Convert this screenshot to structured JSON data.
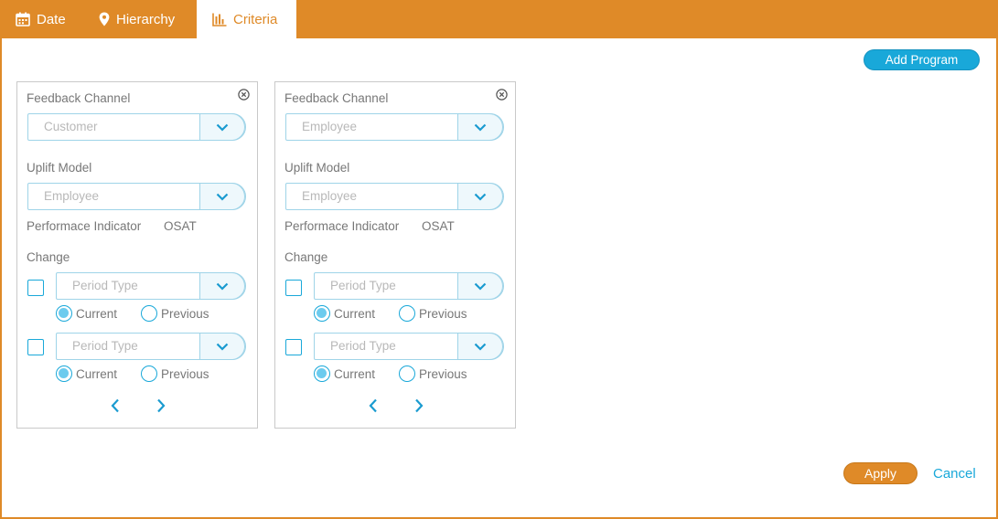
{
  "tabs": [
    {
      "label": "Date",
      "icon": "calendar-icon",
      "active": false
    },
    {
      "label": "Hierarchy",
      "icon": "map-pin-icon",
      "active": false
    },
    {
      "label": "Criteria",
      "icon": "bar-chart-icon",
      "active": true
    }
  ],
  "actions": {
    "add_program": "Add Program",
    "apply": "Apply",
    "cancel": "Cancel"
  },
  "colors": {
    "accent_orange": "#df8a28",
    "accent_blue": "#19a8d9"
  },
  "cards": [
    {
      "feedback_label": "Feedback Channel",
      "feedback_value": "Customer",
      "uplift_label": "Uplift Model",
      "uplift_value": "Employee",
      "kpi_label": "Performace Indicator",
      "kpi_value": "OSAT",
      "change_label": "Change",
      "rows": [
        {
          "placeholder": "Period Type",
          "checked": false,
          "current": "Current",
          "previous": "Previous",
          "selected": "current"
        },
        {
          "placeholder": "Period Type",
          "checked": false,
          "current": "Current",
          "previous": "Previous",
          "selected": "current"
        }
      ]
    },
    {
      "feedback_label": "Feedback Channel",
      "feedback_value": "Employee",
      "uplift_label": "Uplift Model",
      "uplift_value": "Employee",
      "kpi_label": "Performace Indicator",
      "kpi_value": "OSAT",
      "change_label": "Change",
      "rows": [
        {
          "placeholder": "Period Type",
          "checked": false,
          "current": "Current",
          "previous": "Previous",
          "selected": "current"
        },
        {
          "placeholder": "Period Type",
          "checked": false,
          "current": "Current",
          "previous": "Previous",
          "selected": "current"
        }
      ]
    }
  ]
}
